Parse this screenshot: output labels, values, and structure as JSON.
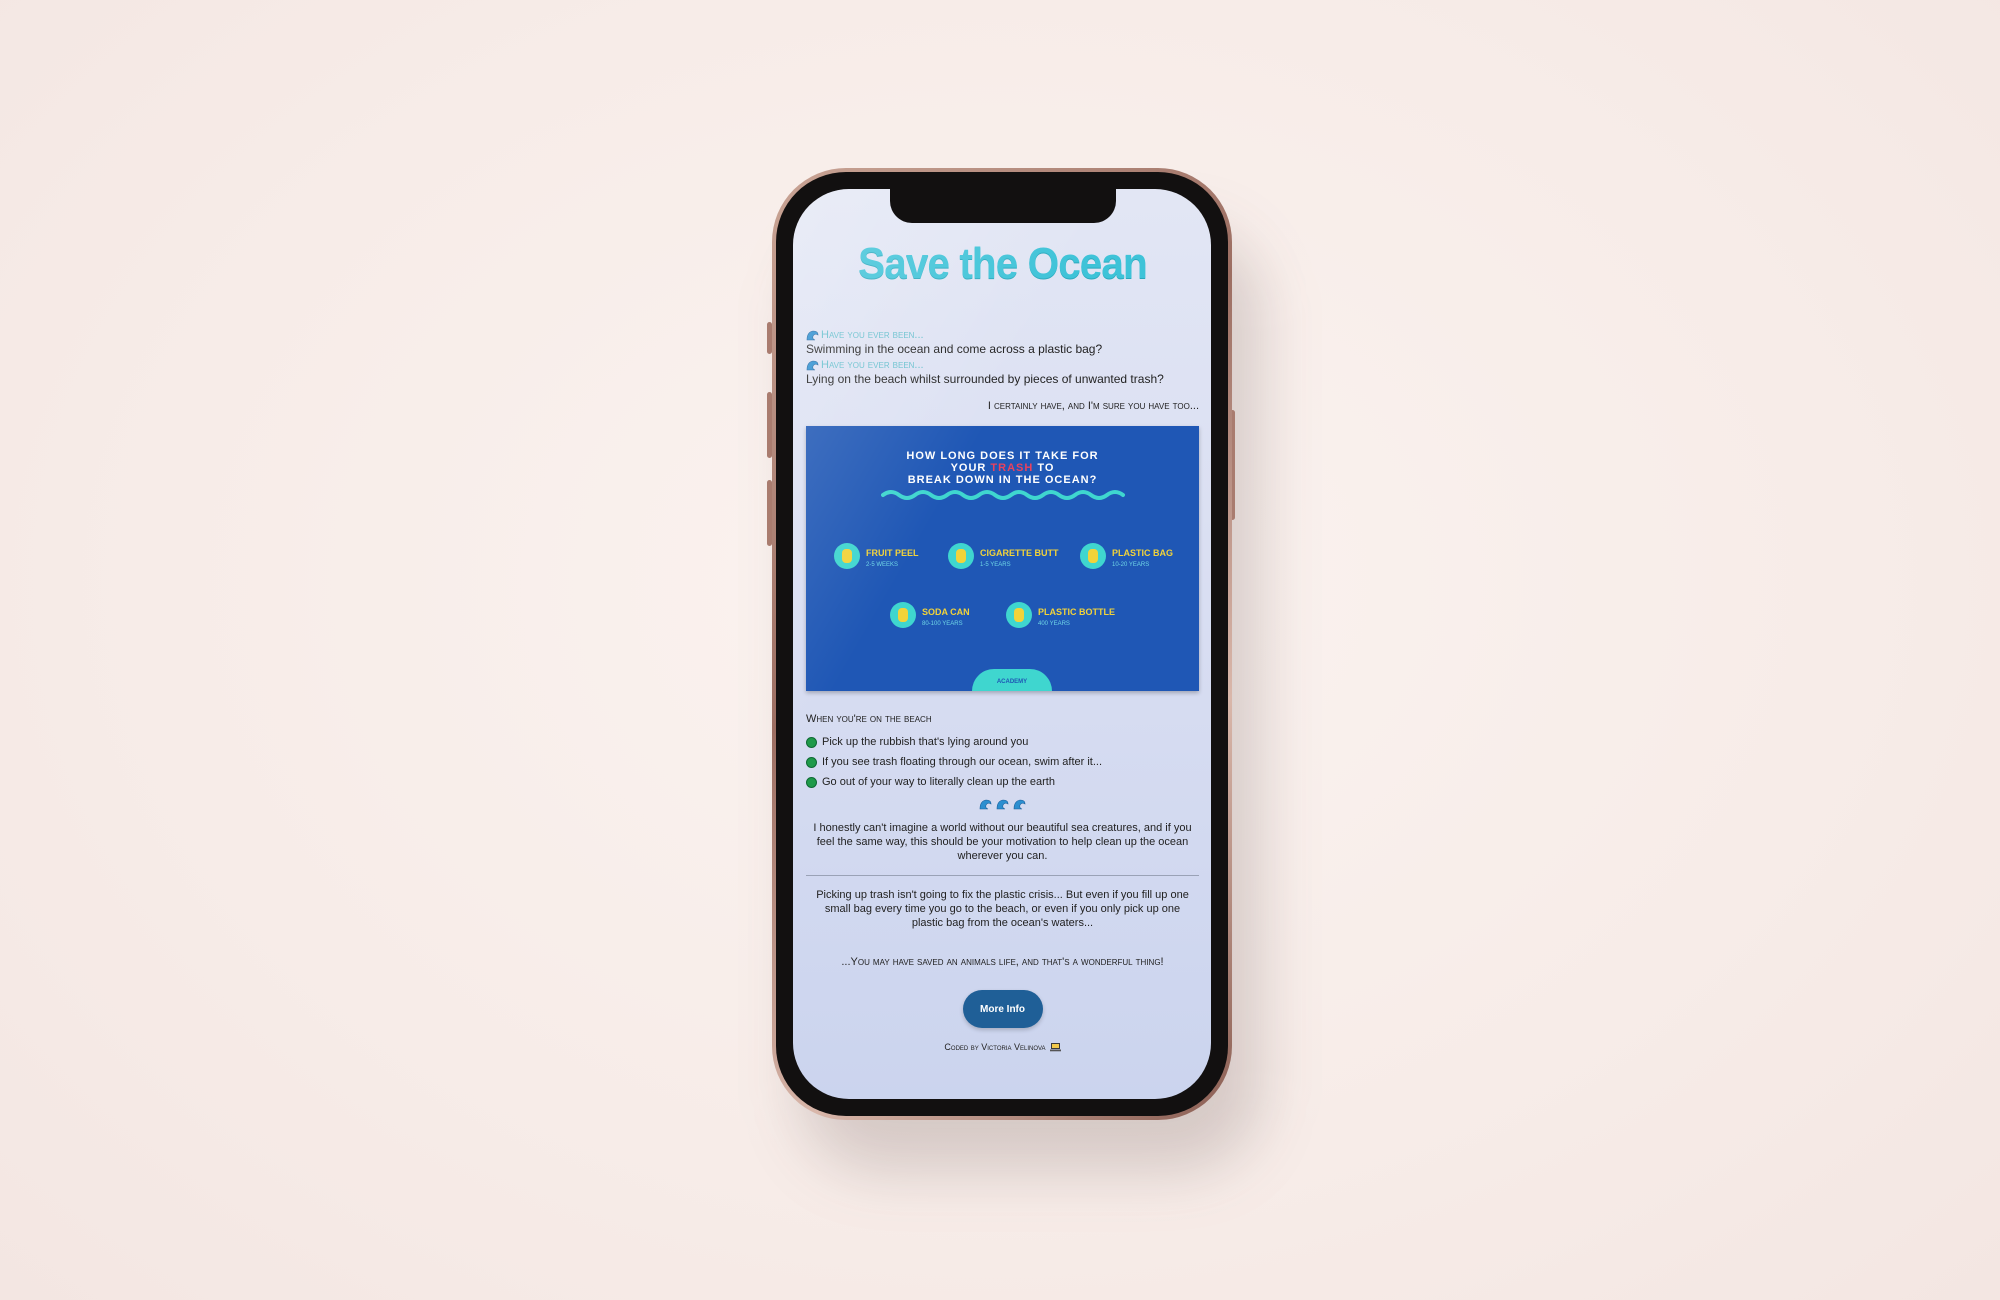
{
  "page": {
    "title": "Save the Ocean",
    "questions": [
      {
        "heading": "Have you ever been...",
        "text": "Swimming in the ocean and come across a plastic bag?"
      },
      {
        "heading": "Have you ever been...",
        "text": "Lying on the beach whilst surrounded by pieces of unwanted trash?"
      }
    ],
    "right_note": "I certainly have, and I'm sure you have too...",
    "infographic": {
      "title_line1": "HOW LONG DOES IT TAKE FOR",
      "title_line2_pre": "YOUR",
      "title_line2_hl": "TRASH",
      "title_line2_post": "TO",
      "title_line3": "BREAK DOWN IN THE OCEAN?",
      "items": [
        {
          "label": "FRUIT PEEL",
          "sub": "2-5 WEEKS"
        },
        {
          "label": "CIGARETTE BUTT",
          "sub": "1-5 YEARS"
        },
        {
          "label": "PLASTIC BAG",
          "sub": "10-20 YEARS"
        },
        {
          "label": "SODA CAN",
          "sub": "80-100 YEARS"
        },
        {
          "label": "PLASTIC BOTTLE",
          "sub": "400 YEARS"
        }
      ],
      "badge": "ACADEMY"
    },
    "beach_heading": "When you're on the beach",
    "tips": [
      "Pick up the rubbish that's lying around you",
      "If you see trash floating through our ocean, swim after it...",
      "Go out of your way to literally clean up the earth"
    ],
    "paragraph1": "I honestly can't imagine a world without our beautiful sea creatures, and if you feel the same way, this should be your motivation to help clean up the ocean wherever you can.",
    "paragraph2": "Picking up trash isn't going to fix the plastic crisis... But even if you fill up one small bag every time you go to the beach, or even if you only pick up one plastic bag from the ocean's waters...",
    "closing": "...You may have saved an animals life, and that's a wonderful thing!",
    "button_label": "More Info",
    "footer": "Coded by Victoria Velinova"
  },
  "colors": {
    "title": "#3ec3d8",
    "accent": "#65bfcd",
    "button": "#1f5f97",
    "infographic_bg": "#1f57b5",
    "bullet": "#1f9a4a"
  }
}
